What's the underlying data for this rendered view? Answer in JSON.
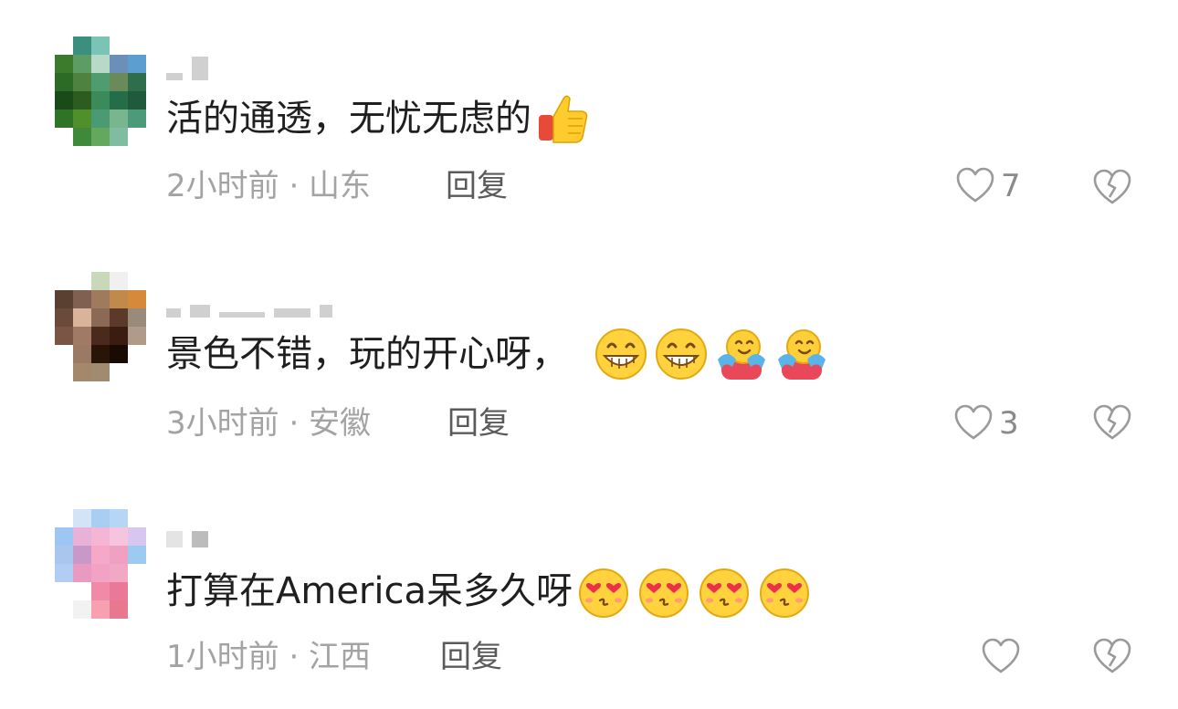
{
  "comments": [
    {
      "text": "活的通透，无忧无虑的",
      "emojis": [
        "thumbs-up"
      ],
      "meta": "2小时前 · 山东",
      "reply_label": "回复",
      "like_count": "7",
      "avatar_colors": [
        "#ffffff",
        "#3a8f7f",
        "#7bc3b4",
        "#ffffff",
        "#ffffff",
        "#3c7a2c",
        "#5d9c64",
        "#b6d9c9",
        "#6b8fb9",
        "#5c9ed0",
        "#2b6b25",
        "#4d8240",
        "#4f9d6e",
        "#6a8a5a",
        "#2f6e4a",
        "#1a4a18",
        "#2c5c1f",
        "#3a8a5a",
        "#236d48",
        "#1f5a3c",
        "#2f7326",
        "#4f8f2c",
        "#4a9a74",
        "#79b58f",
        "#4d9a7a",
        "#ffffff",
        "#3e8a3a",
        "#63a85d",
        "#80bda0",
        "#ffffff"
      ]
    },
    {
      "text": "景色不错，玩的开心呀，",
      "emojis": [
        "grin",
        "grin",
        "hug",
        "hug"
      ],
      "meta": "3小时前 · 安徽",
      "reply_label": "回复",
      "like_count": "3",
      "avatar_colors": [
        "#ffffff",
        "#ffffff",
        "#c9d8b9",
        "#f0f0f0",
        "#ffffff",
        "#5a4030",
        "#806050",
        "#a07a5c",
        "#c08a4a",
        "#d48a3a",
        "#6a4a3a",
        "#d9b49a",
        "#8a6a54",
        "#5c3a2a",
        "#9a8a7a",
        "#7a5444",
        "#a07a64",
        "#4a2a1c",
        "#3a1c10",
        "#b09a8a",
        "#ffffff",
        "#9a7a64",
        "#2a1408",
        "#1a0a04",
        "#ffffff",
        "#ffffff",
        "#a4886c",
        "#a08a70",
        "#ffffff",
        "#ffffff"
      ]
    },
    {
      "text": "打算在America呆多久呀",
      "emojis": [
        "heart-eyes",
        "heart-eyes",
        "heart-eyes",
        "heart-eyes"
      ],
      "meta": "1小时前 · 江西",
      "reply_label": "回复",
      "like_count": "",
      "avatar_colors": [
        "#ffffff",
        "#d3e4f8",
        "#a8cff2",
        "#b6d6f6",
        "#ffffff",
        "#9ec6f2",
        "#e8b2d8",
        "#f4b6d4",
        "#f6c4dc",
        "#d6c6f0",
        "#a9c6ef",
        "#c898c8",
        "#f5a8c8",
        "#f0a0c0",
        "#9ccaf0",
        "#b2cdf3",
        "#e89ac0",
        "#f2a2c4",
        "#f0a8c4",
        "#ffffff",
        "#ffffff",
        "#ffffff",
        "#f08aa8",
        "#ea7898",
        "#ffffff",
        "#ffffff",
        "#f2f2f2",
        "#f7a0b0",
        "#e87890",
        "#ffffff"
      ]
    }
  ],
  "icons": {
    "like": "heart-outline-icon",
    "dislike": "broken-heart-outline-icon"
  }
}
